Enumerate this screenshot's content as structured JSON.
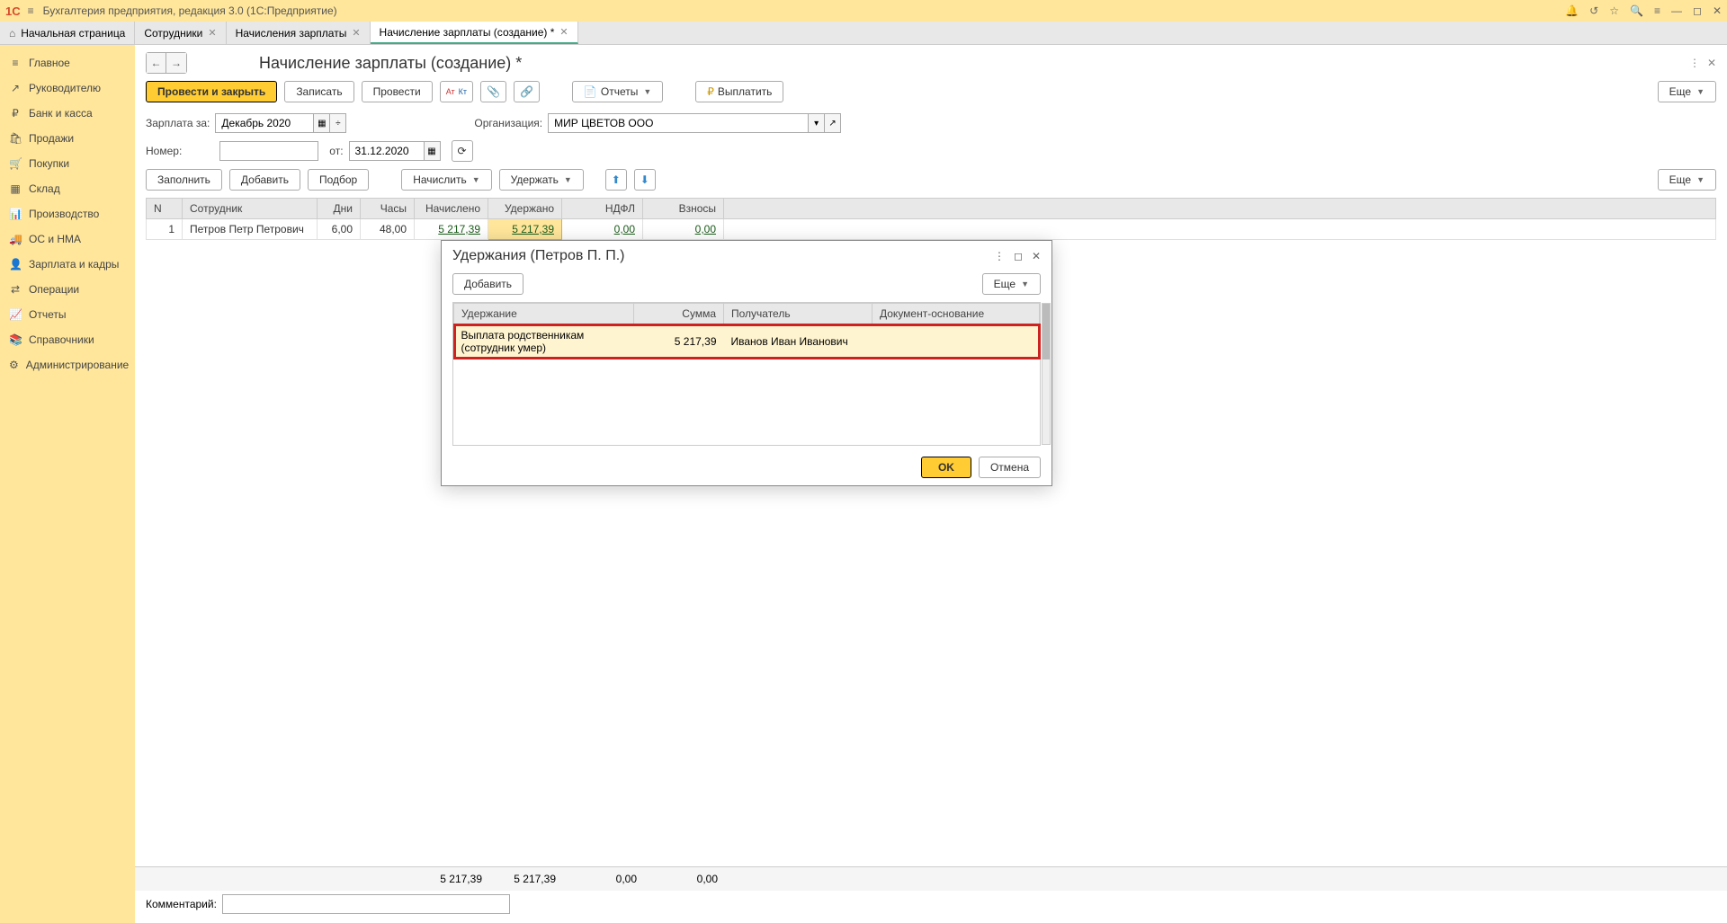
{
  "app": {
    "title": "Бухгалтерия предприятия, редакция 3.0  (1С:Предприятие)"
  },
  "tabs": [
    {
      "label": "Начальная страница",
      "closable": false,
      "home": true
    },
    {
      "label": "Сотрудники",
      "closable": true
    },
    {
      "label": "Начисления зарплаты",
      "closable": true
    },
    {
      "label": "Начисление зарплаты (создание) *",
      "closable": true,
      "active": true
    }
  ],
  "sidebar": {
    "items": [
      {
        "icon": "≡",
        "label": "Главное"
      },
      {
        "icon": "↗",
        "label": "Руководителю"
      },
      {
        "icon": "₽",
        "label": "Банк и касса"
      },
      {
        "icon": "🛍",
        "label": "Продажи"
      },
      {
        "icon": "🛒",
        "label": "Покупки"
      },
      {
        "icon": "▦",
        "label": "Склад"
      },
      {
        "icon": "📊",
        "label": "Производство"
      },
      {
        "icon": "🚚",
        "label": "ОС и НМА"
      },
      {
        "icon": "👤",
        "label": "Зарплата и кадры"
      },
      {
        "icon": "⇄",
        "label": "Операции"
      },
      {
        "icon": "📈",
        "label": "Отчеты"
      },
      {
        "icon": "📚",
        "label": "Справочники"
      },
      {
        "icon": "⚙",
        "label": "Администрирование"
      }
    ]
  },
  "page": {
    "title": "Начисление зарплаты (создание) *",
    "toolbar": {
      "post_close": "Провести и закрыть",
      "save": "Записать",
      "post": "Провести",
      "reports": "Отчеты",
      "pay": "Выплатить",
      "more": "Еще"
    },
    "form": {
      "salary_for_label": "Зарплата за:",
      "salary_for_value": "Декабрь 2020",
      "org_label": "Организация:",
      "org_value": "МИР ЦВЕТОВ ООО",
      "number_label": "Номер:",
      "number_value": "",
      "from_label": "от:",
      "date_value": "31.12.2020",
      "comment_label": "Комментарий:",
      "comment_value": ""
    },
    "toolbar2": {
      "fill": "Заполнить",
      "add": "Добавить",
      "pick": "Подбор",
      "accrue": "Начислить",
      "withhold": "Удержать",
      "more": "Еще"
    },
    "grid": {
      "cols": [
        "N",
        "Сотрудник",
        "Дни",
        "Часы",
        "Начислено",
        "Удержано",
        "НДФЛ",
        "Взносы"
      ],
      "rows": [
        {
          "n": "1",
          "employee": "Петров Петр Петрович",
          "days": "6,00",
          "hours": "48,00",
          "accrued": "5 217,39",
          "withheld": "5 217,39",
          "ndfl": "0,00",
          "contrib": "0,00"
        }
      ],
      "totals": {
        "accrued": "5 217,39",
        "withheld": "5 217,39",
        "ndfl": "0,00",
        "contrib": "0,00"
      }
    }
  },
  "modal": {
    "title": "Удержания (Петров П. П.)",
    "add": "Добавить",
    "more": "Еще",
    "cols": [
      "Удержание",
      "Сумма",
      "Получатель",
      "Документ-основание"
    ],
    "rows": [
      {
        "deduction": "Выплата родственникам (сотрудник умер)",
        "amount": "5 217,39",
        "recipient": "Иванов Иван Иванович",
        "basis": ""
      }
    ],
    "ok": "OK",
    "cancel": "Отмена"
  }
}
